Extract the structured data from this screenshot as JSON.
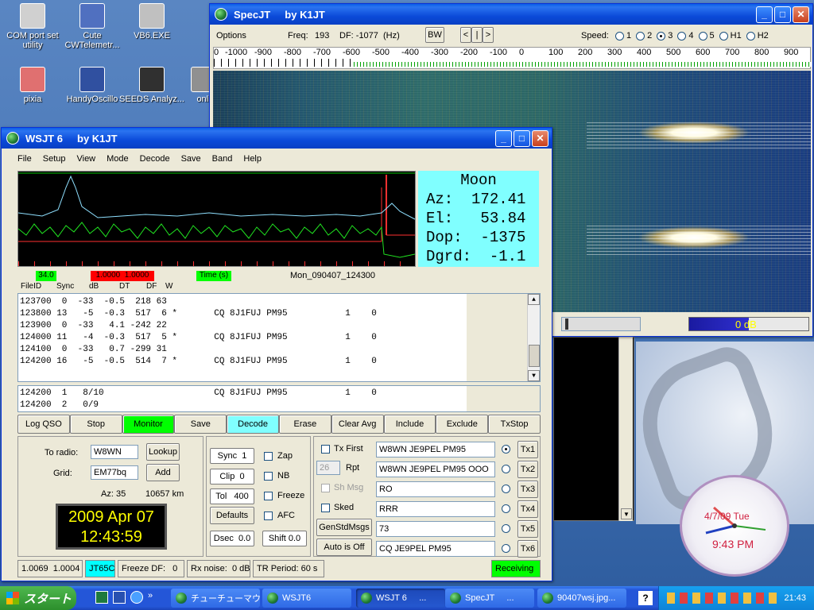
{
  "desktop_icons": [
    {
      "label": "COM port set utility",
      "icon": "com-port-icon",
      "color": "#d0d0d0"
    },
    {
      "label": "Cute CWTelemetr...",
      "icon": "cwtelemetry-icon",
      "color": "#5070c0"
    },
    {
      "label": "VB6.EXE",
      "icon": "vb6-icon",
      "color": "#c0c0c0"
    },
    {
      "label": "pixia",
      "icon": "pixia-icon",
      "color": "#e07070"
    },
    {
      "label": "HandyOscillo",
      "icon": "oscillo-icon",
      "color": "#3050a0"
    },
    {
      "label": "SEEDS Analyz...",
      "icon": "seeds-icon",
      "color": "#303030"
    },
    {
      "label": "onli",
      "icon": "online-icon",
      "color": "#909090"
    }
  ],
  "spec": {
    "title": "SpecJT     by K1JT",
    "options_label": "Options",
    "freq_label": "Freq:",
    "freq_value": "193",
    "df_label": "DF: -1077  (Hz)",
    "bw_label": "BW",
    "nav": [
      "<",
      "|",
      ">"
    ],
    "speed_label": "Speed:",
    "speeds": [
      {
        "label": "1",
        "on": false
      },
      {
        "label": "2",
        "on": false
      },
      {
        "label": "3",
        "on": true
      },
      {
        "label": "4",
        "on": false
      },
      {
        "label": "5",
        "on": false
      },
      {
        "label": "H1",
        "on": false
      },
      {
        "label": "H2",
        "on": false
      }
    ],
    "scale": [
      "0",
      "-1000",
      "-900",
      "-800",
      "-700",
      "-600",
      "-500",
      "-400",
      "-300",
      "-200",
      "-100",
      "0",
      "100",
      "200",
      "300",
      "400",
      "500",
      "600",
      "700",
      "800",
      "900"
    ],
    "level_label": "0 dB"
  },
  "wsjt": {
    "title": "WSJT 6     by K1JT",
    "menu": [
      "File",
      "Setup",
      "View",
      "Mode",
      "Decode",
      "Save",
      "Band",
      "Help"
    ],
    "moon": {
      "title": "Moon",
      "az": "Az:  172.41",
      "el": "El:   53.84",
      "dop": "Dop:  -1375",
      "dgrd": "Dgrd:  -1.1"
    },
    "status_green": "34.0",
    "status_red": "1.0000  1.0000",
    "status_time": "Time (s)",
    "filename": "Mon_090407_124300",
    "headers": [
      "FileID",
      "Sync",
      "dB",
      "DT",
      "DF",
      "W"
    ],
    "decodes": [
      "123700  0  -33  -0.5  218 63",
      "123800 13   -5  -0.3  517  6 *       CQ 8J1FUJ PM95           1    0",
      "123900  0  -33   4.1 -242 22",
      "124000 11   -4  -0.3  517  5 *       CQ 8J1FUJ PM95           1    0",
      "124100  0  -33   0.7 -299 31",
      "124200 16   -5  -0.5  514  7 *       CQ 8J1FUJ PM95           1    0",
      ""
    ],
    "avg_lines": [
      "124200  1   8/10                     CQ 8J1FUJ PM95           1    0",
      "124200  2   0/9"
    ],
    "buttons": [
      {
        "label": "Log QSO",
        "bg": "#ece9d8"
      },
      {
        "label": "Stop",
        "bg": "#ece9d8"
      },
      {
        "label": "Monitor",
        "bg": "#00ff00"
      },
      {
        "label": "Save",
        "bg": "#ece9d8"
      },
      {
        "label": "Decode",
        "bg": "#80ffff"
      },
      {
        "label": "Erase",
        "bg": "#ece9d8"
      },
      {
        "label": "Clear Avg",
        "bg": "#ece9d8"
      },
      {
        "label": "Include",
        "bg": "#ece9d8"
      },
      {
        "label": "Exclude",
        "bg": "#ece9d8"
      },
      {
        "label": "TxStop",
        "bg": "#ece9d8"
      }
    ],
    "to_radio_label": "To radio:",
    "to_radio_value": "W8WN",
    "lookup_label": "Lookup",
    "grid_label": "Grid:",
    "grid_value": "EM77bq",
    "add_label": "Add",
    "az_text": "Az: 35",
    "dist_text": "10657 km",
    "date": "2009 Apr 07",
    "time": "12:43:59",
    "sync_label": "Sync  1",
    "clip_label": "Clip  0",
    "tol_label": "Tol   400",
    "defaults_label": "Defaults",
    "dsec_label": "Dsec  0.0",
    "shift_label": "Shift 0.0",
    "checks": [
      "Zap",
      "NB",
      "Freeze",
      "AFC"
    ],
    "tx_first_label": "Tx First",
    "rpt_value": "26",
    "rpt_label": "Rpt",
    "sh_msg_label": "Sh Msg",
    "sked_label": "Sked",
    "gen_label": "GenStdMsgs",
    "auto_label": "Auto is Off",
    "tx_msgs": [
      {
        "text": "W8WN JE9PEL PM95",
        "btn": "Tx1",
        "on": true
      },
      {
        "text": "W8WN JE9PEL PM95 OOO",
        "btn": "Tx2",
        "on": false
      },
      {
        "text": "RO",
        "btn": "Tx3",
        "on": false
      },
      {
        "text": "RRR",
        "btn": "Tx4",
        "on": false
      },
      {
        "text": "73",
        "btn": "Tx5",
        "on": false
      },
      {
        "text": "CQ JE9PEL PM95",
        "btn": "Tx6",
        "on": false
      }
    ],
    "status_bar": [
      {
        "text": "1.0069  1.0004",
        "bg": "#ece9d8",
        "color": "#000000"
      },
      {
        "text": "JT65C",
        "bg": "#00ffff",
        "color": "#000000"
      },
      {
        "text": "Freeze DF:   0",
        "bg": "#ece9d8",
        "color": "#000000"
      },
      {
        "text": "Rx noise:  0 dB",
        "bg": "#ece9d8",
        "color": "#000000"
      },
      {
        "text": "TR Period: 60 s",
        "bg": "#ece9d8",
        "color": "#000000"
      },
      {
        "text": "Receiving",
        "bg": "#00ff00",
        "color": "#000000"
      }
    ]
  },
  "clock": {
    "date": "4/7/09 Tue",
    "time": "9:43 PM"
  },
  "taskbar": {
    "start_label": "スタート",
    "tasks": [
      {
        "label": "チューチューマウス...",
        "active": false
      },
      {
        "label": "WSJT6",
        "active": false
      },
      {
        "label": "WSJT 6     ...",
        "active": true
      },
      {
        "label": "SpecJT     ...",
        "active": false
      },
      {
        "label": "90407wsj.jpg...",
        "active": false
      }
    ],
    "clock": "21:43"
  }
}
